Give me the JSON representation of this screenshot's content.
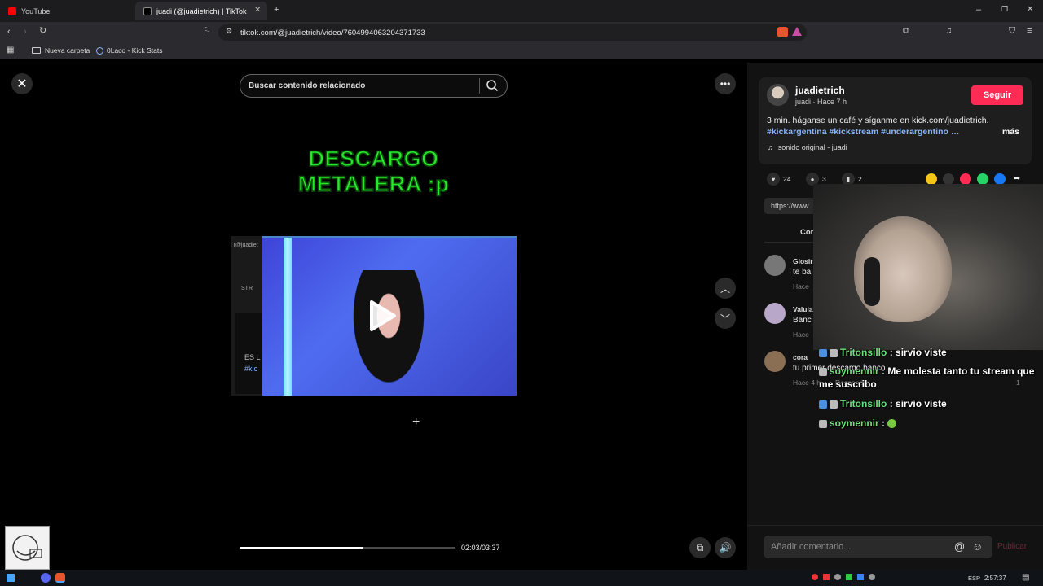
{
  "browser": {
    "tabs": [
      {
        "label": "YouTube",
        "icon": "youtube-icon",
        "color": "#ff0000"
      },
      {
        "label": "juadi (@juadietrich) | TikTok",
        "icon": "tiktok-icon",
        "color": "#ffffff"
      }
    ],
    "url": "tiktok.com/@juadietrich/video/7604994063204371733",
    "bookmarks": [
      {
        "label": "Nueva carpeta",
        "icon": "folder-icon"
      },
      {
        "label": "0Laco - Kick Stats",
        "icon": "kick-icon"
      }
    ]
  },
  "video": {
    "search_placeholder": "Buscar contenido relacionado",
    "title_line1": "DESCARGO",
    "title_line2": "METALERA :p",
    "ghost_text1": "i (@juadiet",
    "ghost_text2": "STR",
    "ghost_text3": "ES L",
    "ghost_text4": "#kic",
    "time": "02:03/03:37",
    "progress": 0.57
  },
  "post": {
    "username": "juadietrich",
    "subline": "juadi · Hace 7 h",
    "follow_label": "Seguir",
    "caption": "3 min. háganse un café y síganme en kick.com/juadietrich.",
    "hashtags": "#kickargentina #kickstream #underargentino …",
    "more_label": "más",
    "sound": "sonido original - juadi",
    "likes": "24",
    "comments": "3",
    "saves": "2",
    "link_text": "https://www",
    "tab_label": "Com"
  },
  "comments": [
    {
      "name": "Glosir",
      "text": "te ba",
      "meta": "Hace"
    },
    {
      "name": "Valula",
      "text": "Banc",
      "meta": "Hace"
    },
    {
      "name": "cora",
      "text": "tu primer descargo banco",
      "meta": "Hace 4 h",
      "reply": "Responder",
      "likes": "1"
    }
  ],
  "chat": [
    {
      "user": "Tritonsillo",
      "msg": ": sirvio viste",
      "blue": true
    },
    {
      "user": "soymennir",
      "msg": ": Me molesta tanto tu stream que me suscribo",
      "blue": false
    },
    {
      "user": "Tritonsillo",
      "msg": ": sirvio viste",
      "blue": true
    },
    {
      "user": "soymennir",
      "msg": ":",
      "blue": false
    }
  ],
  "comment_box": {
    "placeholder": "Añadir comentario...",
    "publish_label": "Publicar"
  },
  "taskbar": {
    "lang": "ESP",
    "clock": "2:57:37"
  },
  "colors": {
    "accent": "#fe2c55",
    "hashtag": "#8ab4f8",
    "title_green": "#27e82a",
    "chat_user": "#6ee07a"
  }
}
